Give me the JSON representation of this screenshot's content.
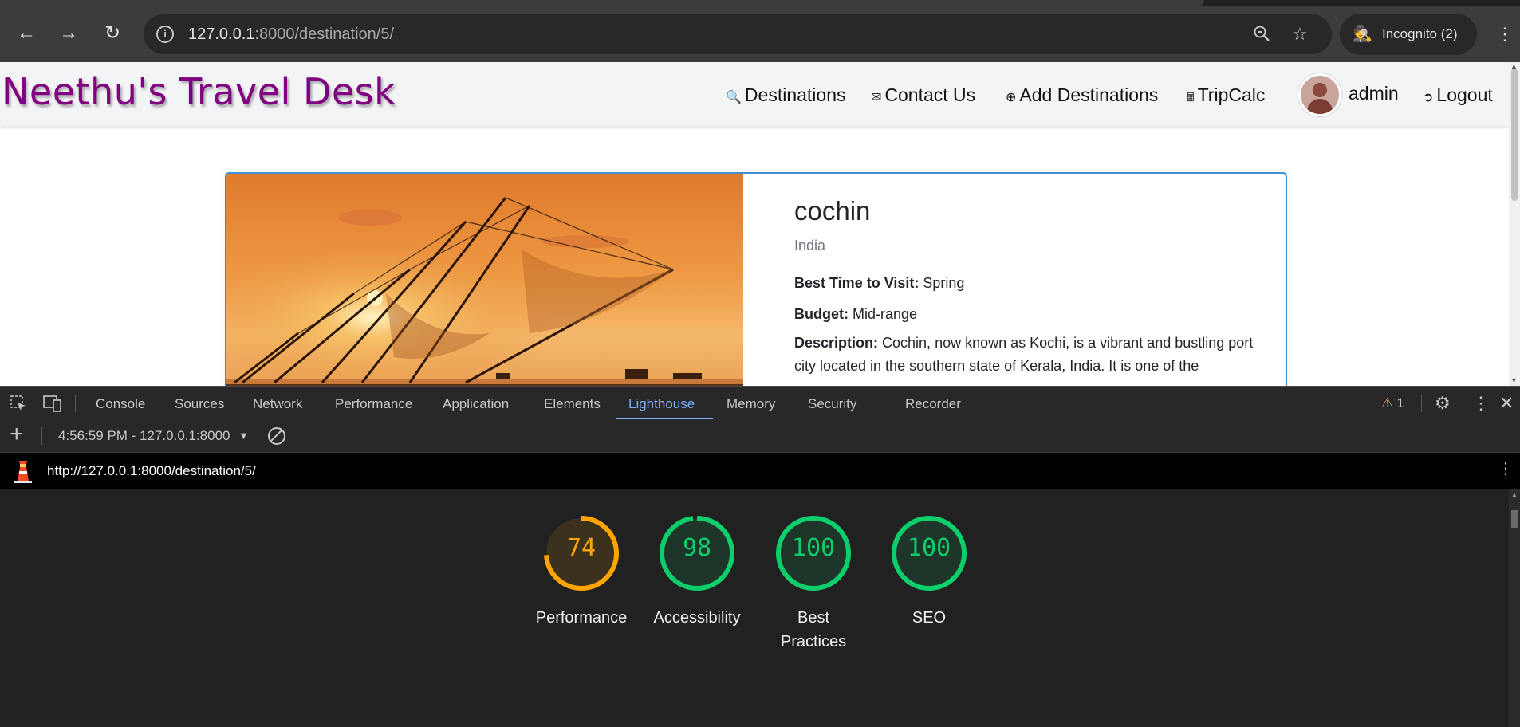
{
  "browser": {
    "url_host": "127.0.0.1",
    "url_path": ":8000/destination/5/",
    "incognito_label": "Incognito (2)"
  },
  "site": {
    "brand": "Neethu's Travel Desk",
    "nav": [
      {
        "label": "Destinations",
        "icon": "search-icon"
      },
      {
        "label": "Contact Us",
        "icon": "envelope-icon"
      },
      {
        "label": "Add Destinations",
        "icon": "plus-circle-icon"
      },
      {
        "label": "TripCalc",
        "icon": "calculator-icon"
      }
    ],
    "user": "admin",
    "logout": "Logout"
  },
  "destination": {
    "name": "cochin",
    "country": "India",
    "best_time_label": "Best Time to Visit:",
    "best_time": "Spring",
    "budget_label": "Budget:",
    "budget": "Mid-range",
    "description_label": "Description:",
    "description": "Cochin, now known as Kochi, is a vibrant and bustling port city located in the southern state of Kerala, India. It is one of the"
  },
  "devtools": {
    "tabs": [
      "Console",
      "Sources",
      "Network",
      "Performance",
      "Application",
      "Elements",
      "Lighthouse",
      "Memory",
      "Security",
      "Recorder"
    ],
    "active_tab": "Lighthouse",
    "warning_count": "1",
    "run_label": "4:56:59 PM - 127.0.0.1:8000"
  },
  "lighthouse": {
    "url": "http://127.0.0.1:8000/destination/5/",
    "scores": [
      {
        "label": "Performance",
        "score": "74",
        "value": 74,
        "color": "#ffa400"
      },
      {
        "label": "Accessibility",
        "score": "98",
        "value": 98,
        "color": "#0cce6b"
      },
      {
        "label": "Best Practices",
        "score": "100",
        "value": 100,
        "color": "#0cce6b"
      },
      {
        "label": "SEO",
        "score": "100",
        "value": 100,
        "color": "#0cce6b"
      }
    ]
  }
}
